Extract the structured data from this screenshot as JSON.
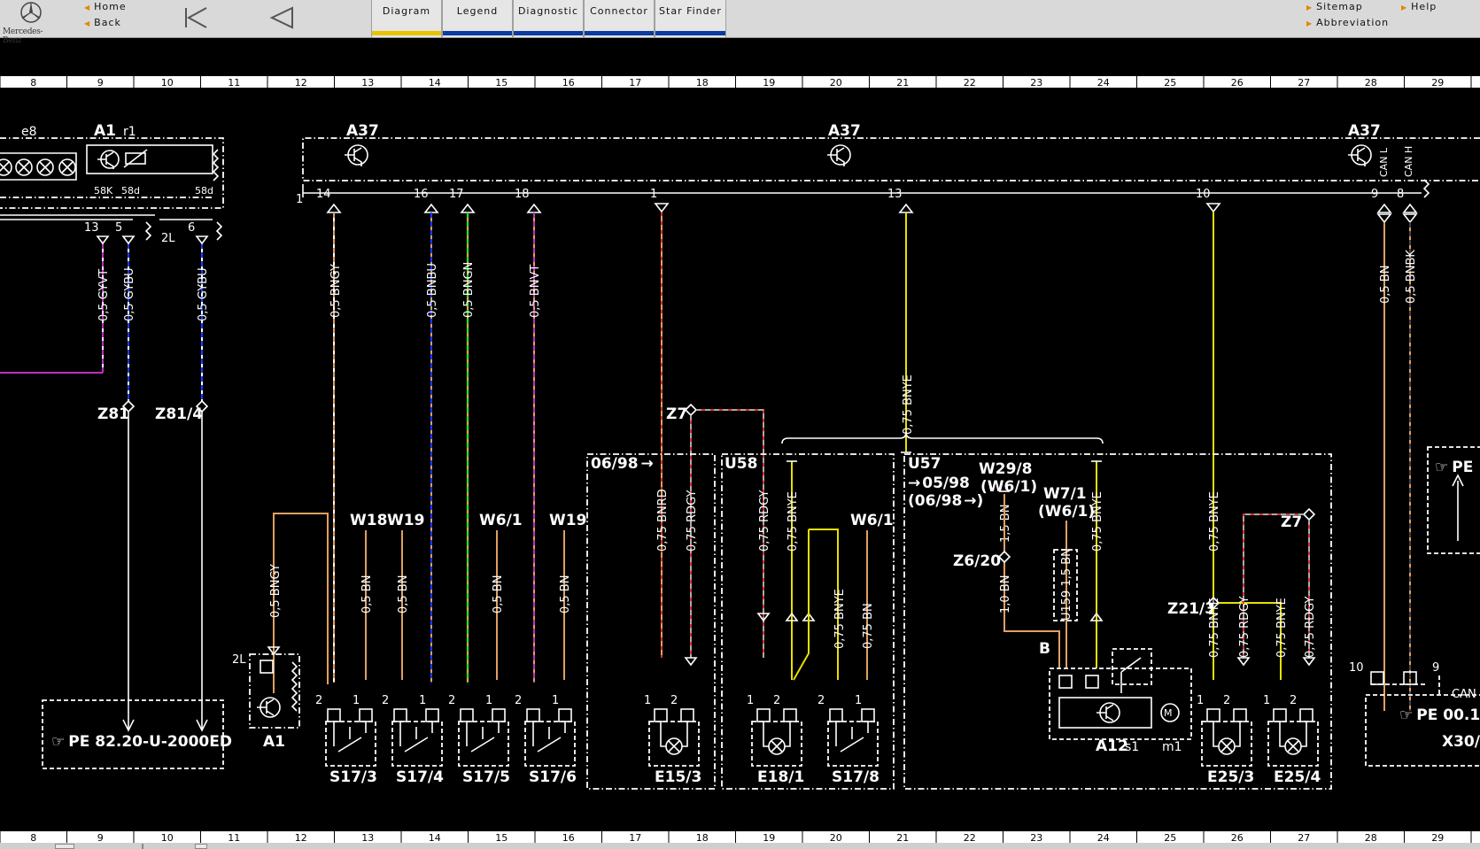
{
  "app": {
    "logo_text": "Mercedes-Benz"
  },
  "nav": {
    "home": "Home",
    "back": "Back",
    "sitemap": "Sitemap",
    "abbreviation": "Abbreviation",
    "help": "Help"
  },
  "tabs": [
    {
      "label": "Diagram",
      "active": true
    },
    {
      "label": "Legend",
      "active": false
    },
    {
      "label": "Diagnostic",
      "active": false
    },
    {
      "label": "Connector",
      "active": false
    },
    {
      "label": "Star Finder",
      "active": false
    }
  ],
  "colors": {
    "accent_active": "#e8c400",
    "accent_tab": "#0b3aa0",
    "nav_arrow": "#e08a00",
    "diagram_bg": "#000000",
    "diagram_line": "#ffffff"
  },
  "diagram": {
    "grid_numbers": [
      "8",
      "9",
      "10",
      "11",
      "12",
      "13",
      "14",
      "15",
      "16",
      "17",
      "18",
      "19",
      "20",
      "21",
      "22",
      "23",
      "24",
      "25",
      "26",
      "27",
      "28",
      "29"
    ],
    "modules": {
      "e8": "e8",
      "a1": "A1",
      "r1": "r1",
      "a37": "A37",
      "can_l": "CAN L",
      "can_h": "CAN H"
    },
    "pins": {
      "p58k": "58K",
      "p58d": "58d",
      "p58d2": "58d",
      "p13": "13",
      "p5": "5",
      "p6": "6",
      "p2l": "2L",
      "p1": "1",
      "p14": "14",
      "p16": "16",
      "p17": "17",
      "p18": "18",
      "p1b": "1",
      "p13b": "13",
      "p10": "10",
      "p9": "9",
      "p8": "8"
    },
    "wires": {
      "gyvt": "0,5 GYVT",
      "gybu": "0,5 GYBU",
      "gybu2": "0,5 GYBU",
      "bngy": "0,5 BNGY",
      "bnbu": "0,5 BNBU",
      "bngn": "0,5 BNGN",
      "bnvt": "0,5 BNVT",
      "bnye_top": "0,75 BNYE",
      "bn_can": "0,5 BN",
      "bnbk": "0,5 BNBK",
      "bngy2": "0,5 BNGY",
      "bn_w18": "0,5 BN",
      "bn_w19": "0,5 BN",
      "bn_w61": "0,5 BN",
      "bn_w19b": "0,5 BN",
      "bnrd": "0,75 BNRD",
      "rdgy": "0,75 RDGY",
      "rdgy2": "0,75 RDGY",
      "bnye_u58": "0,75 BNYE",
      "bnye_e": "0,75 BNYE",
      "bn_s": "0,75 BN",
      "bn15": "1,5 BN",
      "bn10": "1,0 BN",
      "u159": "U159 1,5 BN",
      "bnye_u57": "0,75 BNYE",
      "bnye_z": "0,75 BNYE",
      "bnye_e25": "0,75 BNYE",
      "rdgy_e25": "0,75 RDGY",
      "bnye_e254": "0,75 BNYE",
      "rdgy_e254": "0,75 RDGY"
    },
    "labels": {
      "z81": "Z81",
      "z814": "Z81/4",
      "z7": "Z7",
      "z7b": "Z7",
      "w18": "W18",
      "w19": "W19",
      "w61": "W6/1",
      "w19b": "W19",
      "w61b": "W6/1",
      "u58": "U58",
      "u57": "U57",
      "b0598": "05/98",
      "b0698p": "(06/98",
      "b0698": "06/98",
      "w298": "W29/8",
      "w61p": "(W6/1)",
      "w71": "W7/1",
      "w61p2": "(W6/1)",
      "z620": "Z6/20",
      "z213": "Z21/3",
      "b": "B",
      "p2l_lower": "2L",
      "p10": "10",
      "p9": "9",
      "can": "CAN"
    },
    "components": {
      "a1": "A1",
      "s173": "S17/3",
      "s174": "S17/4",
      "s175": "S17/5",
      "s176": "S17/6",
      "e153": "E15/3",
      "e181": "E18/1",
      "s178": "S17/8",
      "a12": "A12",
      "s1": "s1",
      "m1": "m1",
      "e253": "E25/3",
      "e254": "E25/4",
      "x301": "X30/"
    },
    "refs": {
      "pe_82": "PE  82.20-U-2000ED",
      "pe_right": "PE",
      "pe_x30": "PE  00.1"
    },
    "pin_nums": {
      "n1": "1",
      "n2": "2"
    }
  }
}
